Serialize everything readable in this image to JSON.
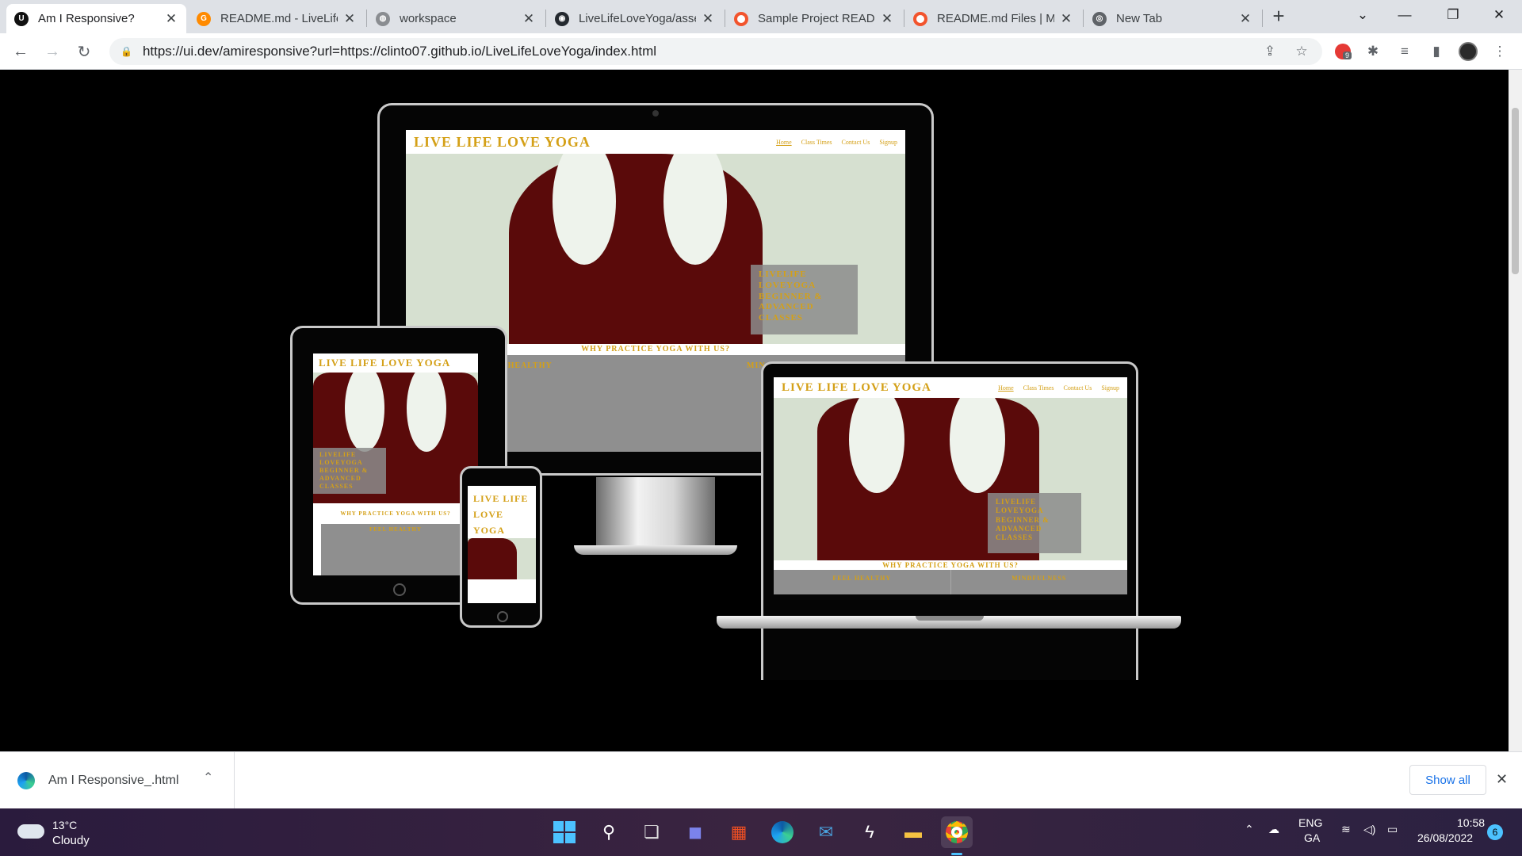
{
  "browser": {
    "tabs": [
      {
        "label": "Am I Responsive?",
        "icon": "amiresponsive-icon",
        "active": true
      },
      {
        "label": "README.md - LiveLife",
        "icon": "gitpod-icon",
        "active": false
      },
      {
        "label": "workspace",
        "icon": "globe-icon",
        "active": false
      },
      {
        "label": "LiveLifeLoveYoga/asse",
        "icon": "github-icon",
        "active": false
      },
      {
        "label": "Sample Project READM",
        "icon": "opera-icon",
        "active": false
      },
      {
        "label": "README.md Files | M",
        "icon": "opera-icon",
        "active": false
      },
      {
        "label": "New Tab",
        "icon": "chrome-icon",
        "active": false
      }
    ],
    "tab_close": "✕",
    "new_tab": "+",
    "url": "https://ui.dev/amiresponsive?url=https://clinto07.github.io/LiveLifeLoveYoga/index.html",
    "extension_badge": "9"
  },
  "site": {
    "title": "LIVE LIFE LOVE YOGA",
    "title_mobile_1": "LIVE LIFE",
    "title_mobile_2": "LOVE",
    "title_mobile_3": "YOGA",
    "nav": [
      "Home",
      "Class Times",
      "Contact Us",
      "Signup"
    ],
    "hero_box": [
      "LIVELIFE",
      "LOVEYOGA",
      "BEGINNER &",
      "ADVANCED",
      "CLASSES"
    ],
    "band": "WHY PRACTICE YOGA WITH US?",
    "feel_healthy": "FEEL HEALTHY",
    "feel_healthy_partial": "L HEALTHY",
    "mindfulness": "MINDFULNESS",
    "mindfulness_partial": "MIN"
  },
  "download_bar": {
    "filename": "Am I Responsive_.html",
    "show_all": "Show all"
  },
  "taskbar": {
    "weather_temp": "13°C",
    "weather_desc": "Cloudy",
    "lang_1": "ENG",
    "lang_2": "GA",
    "time": "10:58",
    "date": "26/08/2022",
    "notif_count": "6"
  },
  "colors": {
    "site_gold": "#d4a017",
    "hero_bg": "#d6e0d0",
    "hero_figure": "#5a0a0a"
  }
}
